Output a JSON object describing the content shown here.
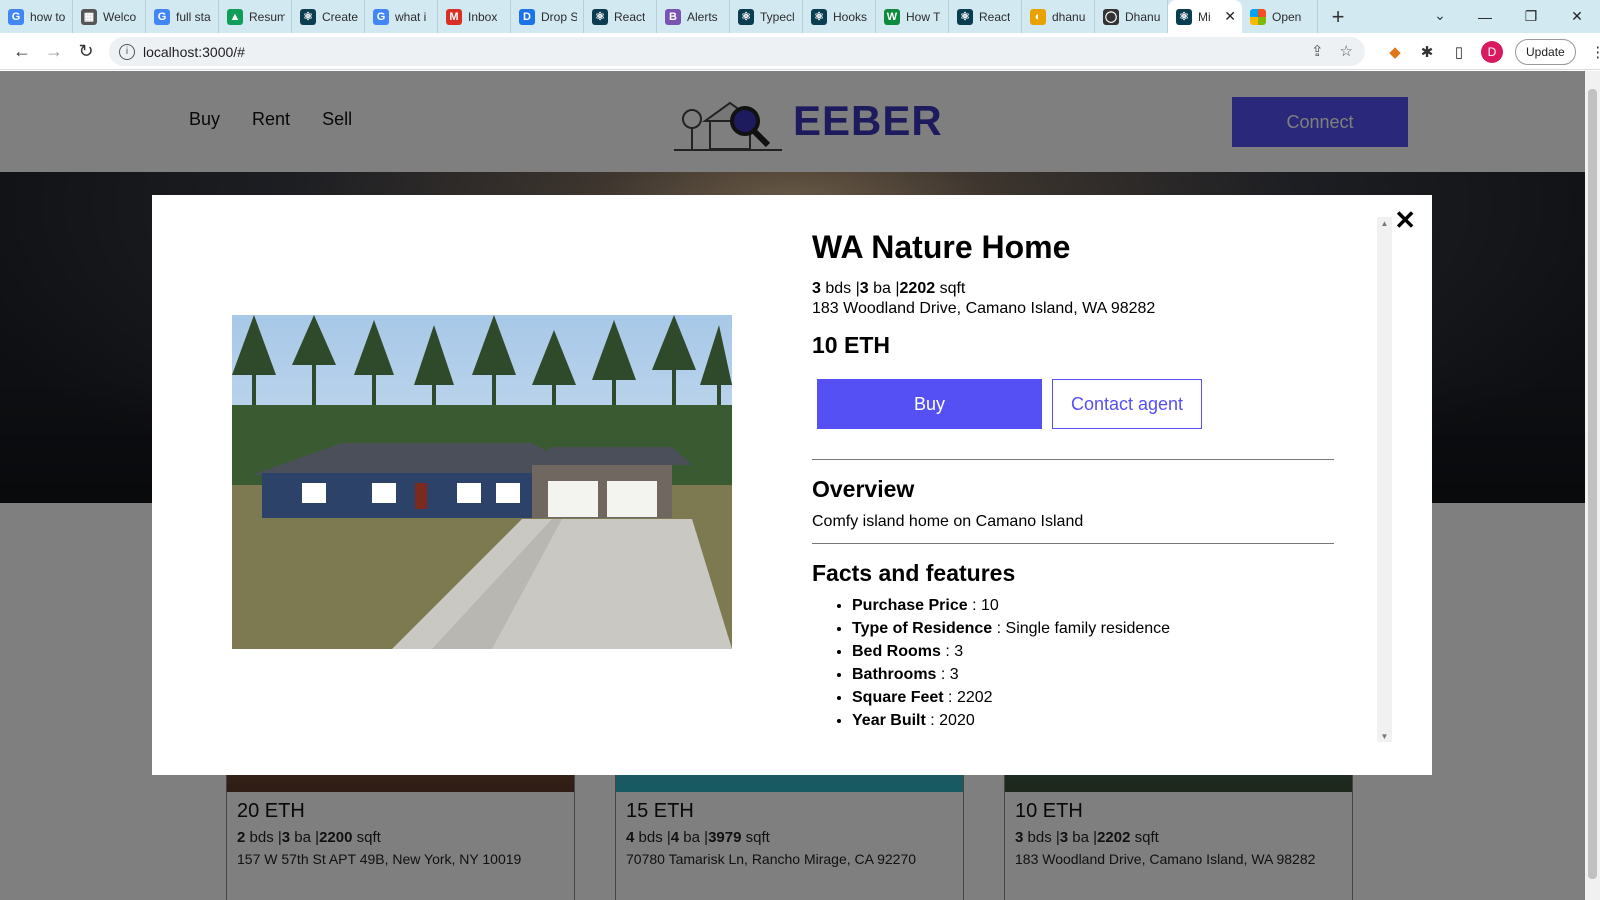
{
  "browser": {
    "tabs": [
      {
        "label": "how to",
        "fav_color": "#4285f4",
        "fav_glyph": "G"
      },
      {
        "label": "Welco",
        "fav_color": "#555555",
        "fav_glyph": "▦"
      },
      {
        "label": "full sta",
        "fav_color": "#4285f4",
        "fav_glyph": "G"
      },
      {
        "label": "Resum",
        "fav_color": "#0f9d58",
        "fav_glyph": "▲"
      },
      {
        "label": "Create",
        "fav_color": "#0b3d50",
        "fav_glyph": "⚛"
      },
      {
        "label": "what i",
        "fav_color": "#4285f4",
        "fav_glyph": "G"
      },
      {
        "label": "Inbox",
        "fav_color": "#d93025",
        "fav_glyph": "M"
      },
      {
        "label": "Drop S",
        "fav_color": "#1a73e8",
        "fav_glyph": "D"
      },
      {
        "label": "React",
        "fav_color": "#0b3d50",
        "fav_glyph": "⚛"
      },
      {
        "label": "Alerts",
        "fav_color": "#7952b3",
        "fav_glyph": "B"
      },
      {
        "label": "Typecl",
        "fav_color": "#0b3d50",
        "fav_glyph": "⚛"
      },
      {
        "label": "Hooks",
        "fav_color": "#0b3d50",
        "fav_glyph": "⚛"
      },
      {
        "label": "How T",
        "fav_color": "#0c8a3e",
        "fav_glyph": "W"
      },
      {
        "label": "React",
        "fav_color": "#0b3d50",
        "fav_glyph": "⚛"
      },
      {
        "label": "dhanu",
        "fav_color": "#e8a200",
        "fav_glyph": "◐"
      },
      {
        "label": "Dhanu",
        "fav_color": "#333333",
        "fav_glyph": "◯"
      }
    ],
    "active_tab": {
      "label": "Mi",
      "fav_glyph": "⚛"
    },
    "last_tab": {
      "label": "Open"
    },
    "new_tab": "+",
    "url": "localhost:3000/#",
    "update_label": "Update",
    "profile_initial": "D"
  },
  "site": {
    "nav": [
      "Buy",
      "Rent",
      "Sell"
    ],
    "logo_text": "EEBER",
    "connect_label": "Connect"
  },
  "cards": [
    {
      "price": "20 ETH",
      "beds": "2",
      "baths": "3",
      "sqft": "2200",
      "address": "157 W 57th St APT 49B, New York, NY 10019"
    },
    {
      "price": "15 ETH",
      "beds": "4",
      "baths": "4",
      "sqft": "3979",
      "address": "70780 Tamarisk Ln, Rancho Mirage, CA 92270"
    },
    {
      "price": "10 ETH",
      "beds": "3",
      "baths": "3",
      "sqft": "2202",
      "address": "183 Woodland Drive, Camano Island, WA 98282"
    }
  ],
  "labels": {
    "bds": "bds",
    "ba": "ba",
    "sqft": "sqft",
    "sep": "|"
  },
  "modal": {
    "title": "WA Nature Home",
    "beds": "3",
    "baths": "3",
    "sqft": "2202",
    "address": "183 Woodland Drive, Camano Island, WA 98282",
    "price": "10 ETH",
    "buy_label": "Buy",
    "contact_label": "Contact agent",
    "overview_heading": "Overview",
    "overview_text": "Comfy island home on Camano Island",
    "facts_heading": "Facts and features",
    "facts": [
      {
        "label": "Purchase Price",
        "value": "10"
      },
      {
        "label": "Type of Residence",
        "value": "Single family residence"
      },
      {
        "label": "Bed Rooms",
        "value": "3"
      },
      {
        "label": "Bathrooms",
        "value": "3"
      },
      {
        "label": "Square Feet",
        "value": "2202"
      },
      {
        "label": "Year Built",
        "value": "2020"
      }
    ],
    "close_glyph": "✕"
  },
  "colors": {
    "accent": "#5550f4",
    "logo": "#3a34ba"
  }
}
